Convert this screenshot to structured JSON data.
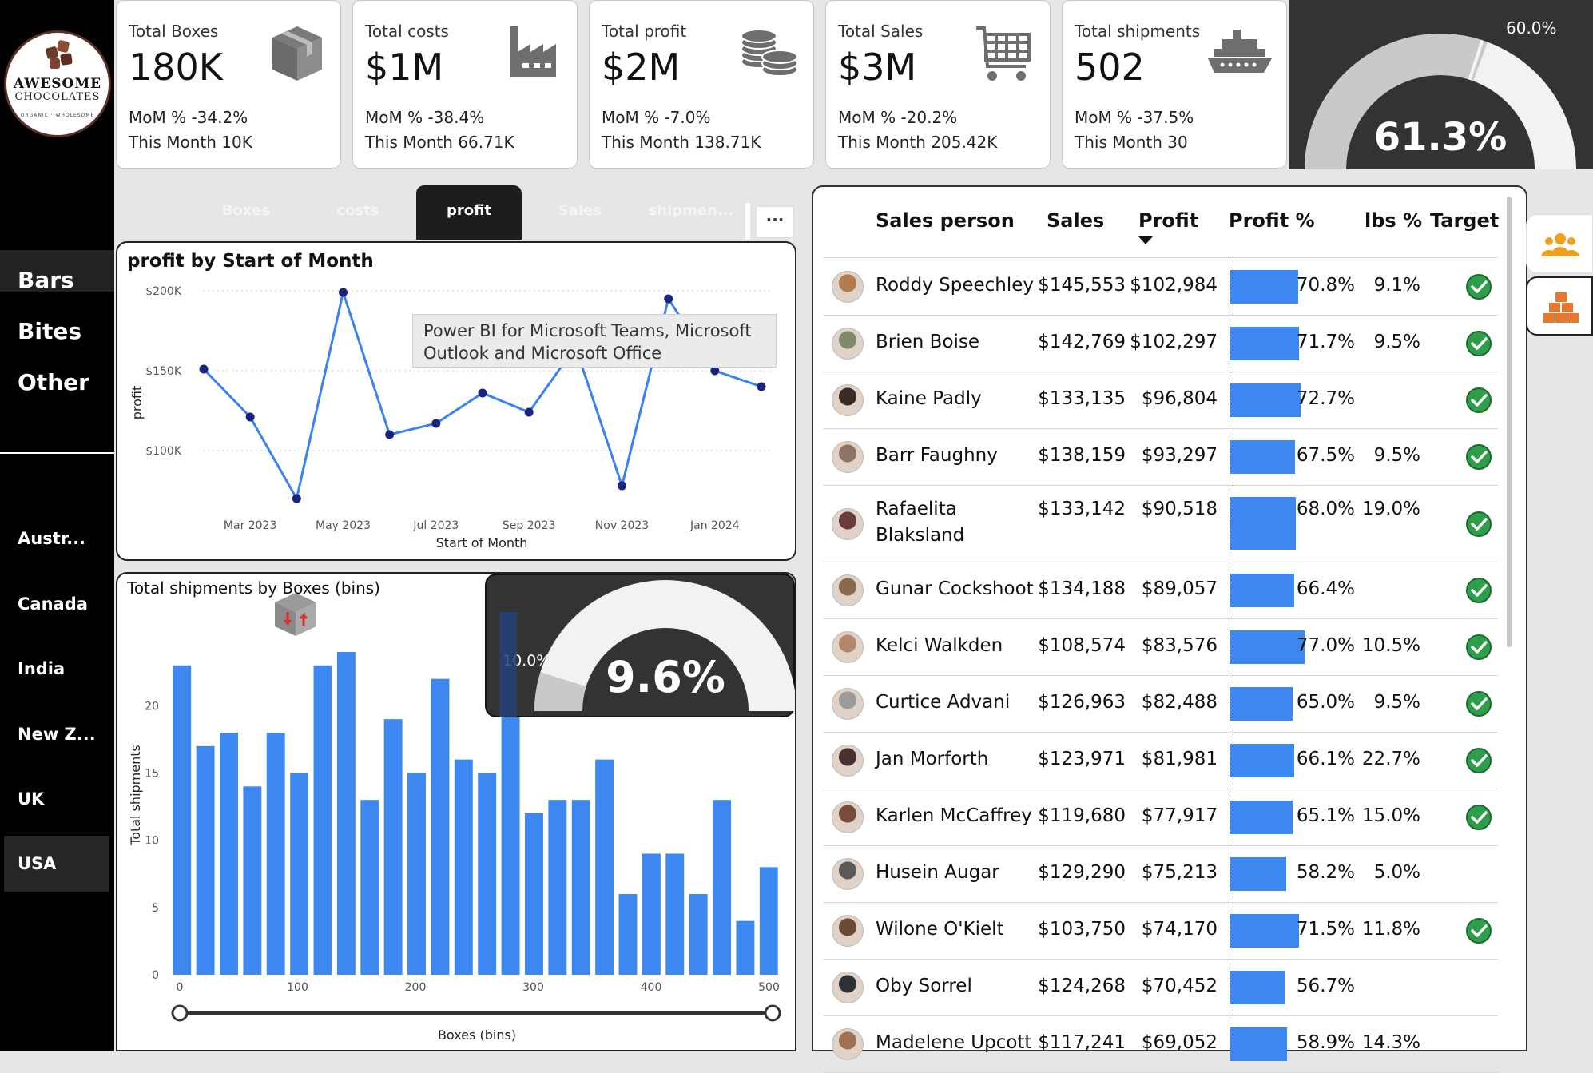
{
  "brand": {
    "line1": "AWESOME",
    "line2": "CHOCOLATES",
    "line3": "ORGANIC · WHOLESOME"
  },
  "categories": [
    {
      "label": "Bars",
      "selected": true
    },
    {
      "label": "Bites",
      "selected": false
    },
    {
      "label": "Other",
      "selected": false
    }
  ],
  "countries": [
    {
      "label": "Austr...",
      "selected": false
    },
    {
      "label": "Canada",
      "selected": false
    },
    {
      "label": "India",
      "selected": false
    },
    {
      "label": "New Z...",
      "selected": false
    },
    {
      "label": "UK",
      "selected": false
    },
    {
      "label": "USA",
      "selected": true
    }
  ],
  "kpis": [
    {
      "label": "Total Boxes",
      "value": "180K",
      "mom": "MoM % -34.2%",
      "this_month": "This Month 10K",
      "icon": "box-icon"
    },
    {
      "label": "Total costs",
      "value": "$1M",
      "mom": "MoM % -38.4%",
      "this_month": "This Month 66.71K",
      "icon": "factory-icon"
    },
    {
      "label": "Total profit",
      "value": "$2M",
      "mom": "MoM % -7.0%",
      "this_month": "This Month 138.71K",
      "icon": "coins-icon"
    },
    {
      "label": "Total Sales",
      "value": "$3M",
      "mom": "MoM % -20.2%",
      "this_month": "This Month 205.42K",
      "icon": "cart-icon"
    },
    {
      "label": "Total shipments",
      "value": "502",
      "mom": "MoM % -37.5%",
      "this_month": "This Month 30",
      "icon": "ship-icon"
    }
  ],
  "gauge_top": {
    "value_label": "61.3%",
    "target_label": "60.0%",
    "value": 61.3,
    "target": 60.0
  },
  "tabs": [
    {
      "label": "Boxes",
      "active": false
    },
    {
      "label": "costs",
      "active": false
    },
    {
      "label": "profit",
      "active": true
    },
    {
      "label": "Sales",
      "active": false
    },
    {
      "label": "shipmen...",
      "active": false
    }
  ],
  "more_label": "···",
  "tooltip": {
    "line1": "Power BI for Microsoft Teams, Microsoft",
    "line2": "Outlook and Microsoft Office"
  },
  "line_chart": {
    "chart_data": {
      "type": "line",
      "title": "profit by Start of Month",
      "xlabel": "Start of Month",
      "ylabel": "profit",
      "y_ticks": [
        "$100K",
        "$150K",
        "$200K"
      ],
      "x_ticks": [
        "Mar 2023",
        "May 2023",
        "Jul 2023",
        "Sep 2023",
        "Nov 2023",
        "Jan 2024"
      ],
      "x": [
        "Feb 2023",
        "Mar 2023",
        "Apr 2023",
        "May 2023",
        "Jun 2023",
        "Jul 2023",
        "Aug 2023",
        "Sep 2023",
        "Oct 2023",
        "Nov 2023",
        "Dec 2023",
        "Jan 2024",
        "Feb 2024"
      ],
      "values": [
        151000,
        121000,
        70000,
        199000,
        110000,
        117000,
        136000,
        124000,
        165000,
        78000,
        195000,
        150000,
        140000
      ],
      "ylim": [
        60000,
        210000
      ]
    }
  },
  "bar_chart": {
    "chart_data": {
      "type": "bar",
      "title": "Total shipments by Boxes (bins)",
      "xlabel": "Boxes (bins)",
      "ylabel": "Total shipments",
      "x_ticks": [
        "0",
        "100",
        "200",
        "300",
        "400",
        "500"
      ],
      "y_ticks": [
        "0",
        "5",
        "10",
        "15",
        "20"
      ],
      "values": [
        23,
        17,
        18,
        14,
        18,
        15,
        23,
        24,
        13,
        19,
        15,
        22,
        16,
        15,
        24,
        12,
        13,
        13,
        16,
        6,
        9,
        9,
        6,
        13,
        4,
        8
      ],
      "ylim": [
        0,
        24
      ]
    }
  },
  "gauge_mid": {
    "value_label": "9.6%",
    "target_label": "10.0%",
    "value": 9.6,
    "target": 10.0
  },
  "table": {
    "headers": {
      "name": "Sales person",
      "sales": "Sales",
      "profit": "Profit",
      "profit_pct": "Profit %",
      "lbs_pct": "lbs %",
      "target": "Target"
    },
    "rows": [
      {
        "name": "Roddy Speechley",
        "name2": "",
        "sales": "$145,553",
        "profit": "$102,984",
        "profit_pct": "70.8%",
        "pct": 70.8,
        "lbs": "9.1%",
        "target": true,
        "avatar": "#b37a4c"
      },
      {
        "name": "Brien Boise",
        "name2": "",
        "sales": "$142,769",
        "profit": "$102,297",
        "profit_pct": "71.7%",
        "pct": 71.7,
        "lbs": "9.5%",
        "target": true,
        "avatar": "#7d8a6b"
      },
      {
        "name": "Kaine Padly",
        "name2": "",
        "sales": "$133,135",
        "profit": "$96,804",
        "profit_pct": "72.7%",
        "pct": 72.7,
        "lbs": "",
        "target": true,
        "avatar": "#3a2d28"
      },
      {
        "name": "Barr Faughny",
        "name2": "",
        "sales": "$138,159",
        "profit": "$93,297",
        "profit_pct": "67.5%",
        "pct": 67.5,
        "lbs": "9.5%",
        "target": true,
        "avatar": "#8c7466"
      },
      {
        "name": "Rafaelita",
        "name2": "Blaksland",
        "sales": "$133,142",
        "profit": "$90,518",
        "profit_pct": "68.0%",
        "pct": 68.0,
        "lbs": "19.0%",
        "target": true,
        "avatar": "#6a3b3f"
      },
      {
        "name": "Gunar Cockshoot",
        "name2": "",
        "sales": "$134,188",
        "profit": "$89,057",
        "profit_pct": "66.4%",
        "pct": 66.4,
        "lbs": "",
        "target": true,
        "avatar": "#8a6a4f"
      },
      {
        "name": "Kelci Walkden",
        "name2": "",
        "sales": "$108,574",
        "profit": "$83,576",
        "profit_pct": "77.0%",
        "pct": 77.0,
        "lbs": "10.5%",
        "target": true,
        "avatar": "#b5876a"
      },
      {
        "name": "Curtice Advani",
        "name2": "",
        "sales": "$126,963",
        "profit": "$82,488",
        "profit_pct": "65.0%",
        "pct": 65.0,
        "lbs": "9.5%",
        "target": true,
        "avatar": "#9b9b9b"
      },
      {
        "name": "Jan Morforth",
        "name2": "",
        "sales": "$123,971",
        "profit": "$81,981",
        "profit_pct": "66.1%",
        "pct": 66.1,
        "lbs": "22.7%",
        "target": true,
        "avatar": "#4b3030"
      },
      {
        "name": "Karlen McCaffrey",
        "name2": "",
        "sales": "$119,680",
        "profit": "$77,917",
        "profit_pct": "65.1%",
        "pct": 65.1,
        "lbs": "15.0%",
        "target": true,
        "avatar": "#7a4a3a"
      },
      {
        "name": "Husein Augar",
        "name2": "",
        "sales": "$129,290",
        "profit": "$75,213",
        "profit_pct": "58.2%",
        "pct": 58.2,
        "lbs": "5.0%",
        "target": false,
        "avatar": "#5a5a5a"
      },
      {
        "name": "Wilone O'Kielt",
        "name2": "",
        "sales": "$103,750",
        "profit": "$74,170",
        "profit_pct": "71.5%",
        "pct": 71.5,
        "lbs": "11.8%",
        "target": true,
        "avatar": "#6b4a35"
      },
      {
        "name": "Oby Sorrel",
        "name2": "",
        "sales": "$124,268",
        "profit": "$70,452",
        "profit_pct": "56.7%",
        "pct": 56.7,
        "lbs": "",
        "target": false,
        "avatar": "#2d3238"
      },
      {
        "name": "Madelene Upcott",
        "name2": "",
        "sales": "$117,241",
        "profit": "$69,052",
        "profit_pct": "58.9%",
        "pct": 58.9,
        "lbs": "14.3%",
        "target": false,
        "avatar": "#a07050"
      }
    ]
  },
  "colors": {
    "accent": "#3d87f0",
    "line": "#3b82f0",
    "marker": "#1a237e",
    "check": "#2e9e4a",
    "gauge_fill": "#cfcfcf",
    "gauge_bg": "#f2f2f2"
  }
}
